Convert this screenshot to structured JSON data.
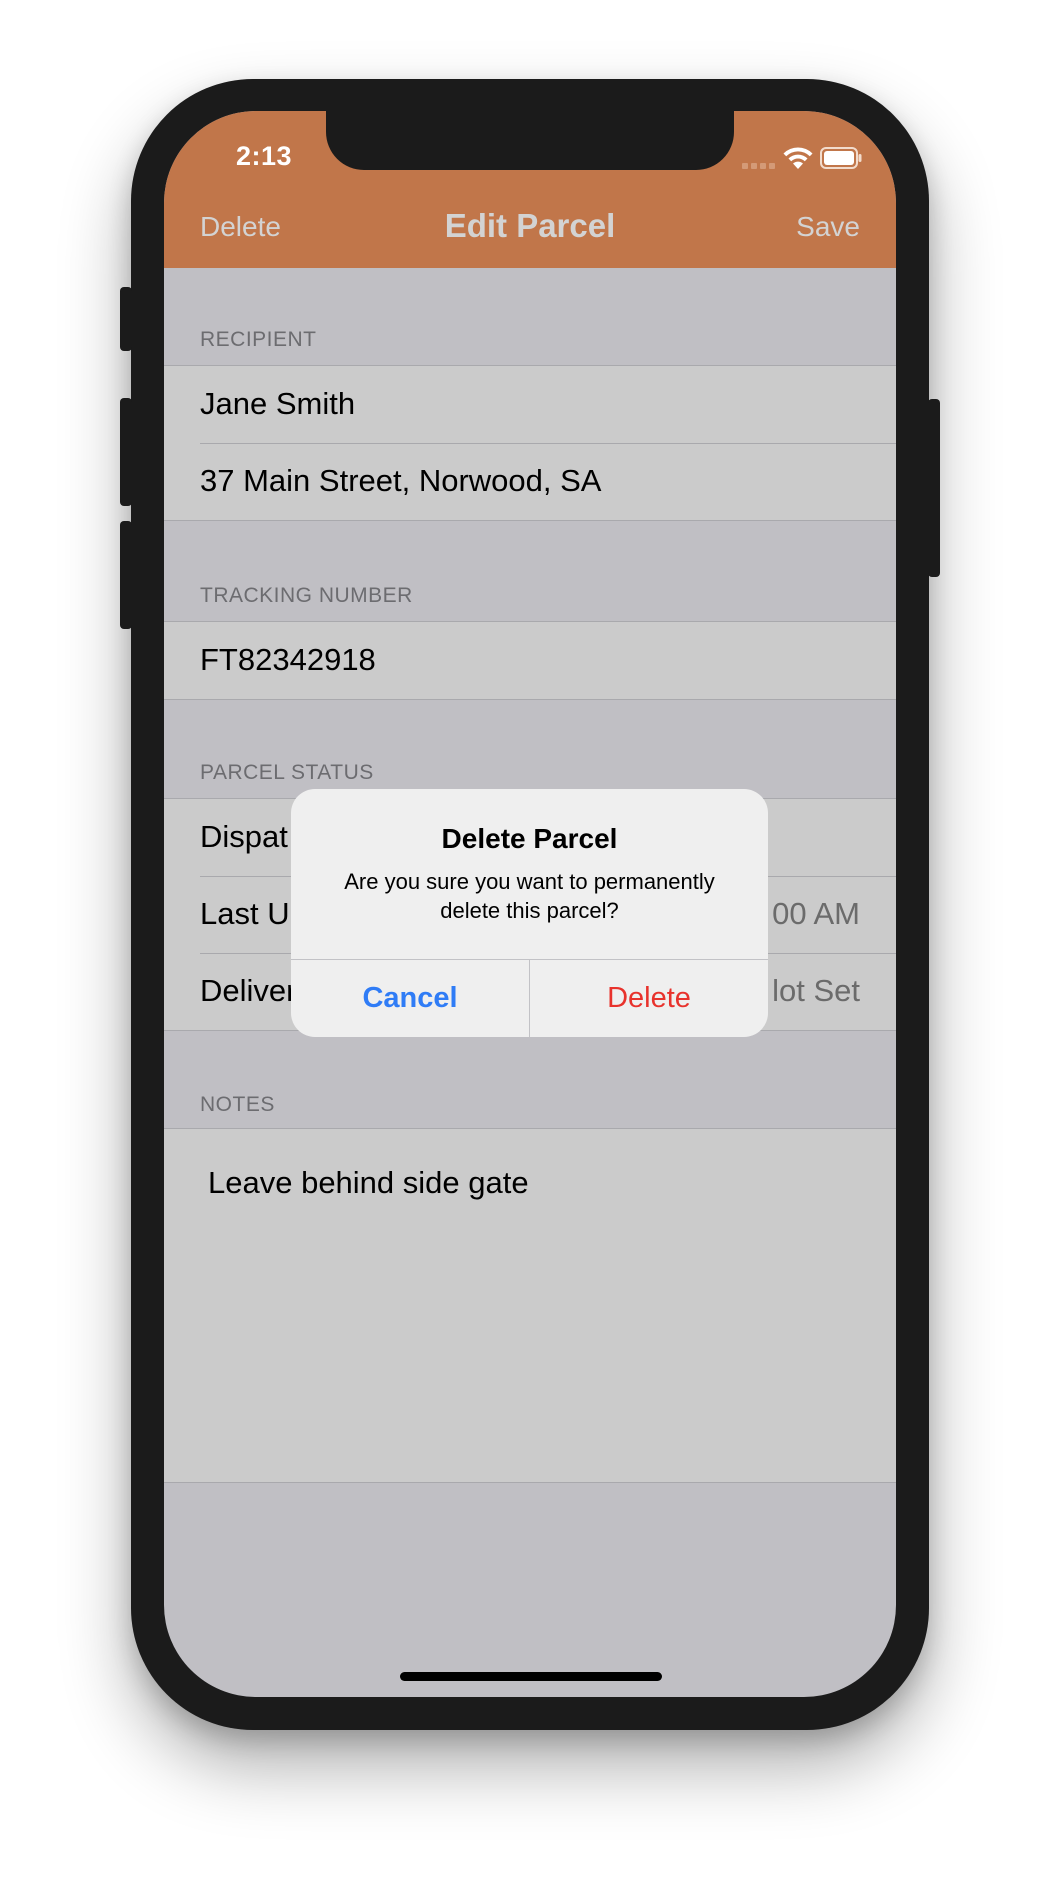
{
  "status_bar": {
    "time": "2:13"
  },
  "navbar": {
    "left_button": "Delete",
    "title": "Edit Parcel",
    "right_button": "Save",
    "color": "#c1764a"
  },
  "recipient": {
    "header": "RECIPIENT",
    "name": "Jane Smith",
    "address": "37 Main Street, Norwood, SA"
  },
  "tracking": {
    "header": "TRACKING NUMBER",
    "number": "FT82342918"
  },
  "status": {
    "header": "PARCEL STATUS",
    "rows": [
      {
        "label": "Dispat",
        "value": ""
      },
      {
        "label": "Last U",
        "value": "00 AM"
      },
      {
        "label": "Deliver",
        "value": "lot Set"
      }
    ]
  },
  "notes": {
    "header": "NOTES",
    "text": "Leave behind side gate"
  },
  "alert": {
    "title": "Delete Parcel",
    "message": "Are you sure you want to permanently delete this parcel?",
    "cancel_label": "Cancel",
    "delete_label": "Delete",
    "cancel_color": "#2f7cf6",
    "delete_color": "#e8322c"
  }
}
